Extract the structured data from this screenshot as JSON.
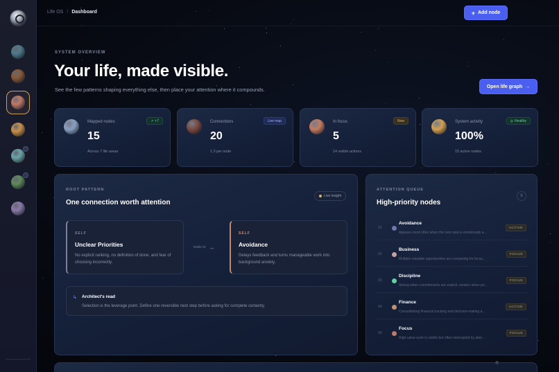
{
  "colors": {
    "accent": "#4a5ef0",
    "active_border": "#c9a25e",
    "green": "#5fd3a1",
    "amber": "#d9b36a"
  },
  "sidebar": {
    "logo_icon": "atom-logo-icon",
    "items": [
      {
        "icon": "earth-planet-icon",
        "color": "#4f7a8a"
      },
      {
        "icon": "ringed-planet-icon",
        "color": "#8a5a3a"
      },
      {
        "icon": "mars-planet-icon",
        "color": "#c07a66",
        "active": true
      },
      {
        "icon": "jupiter-planet-icon",
        "color": "#c8914a"
      },
      {
        "icon": "uranus-planet-icon",
        "color": "#6aa6a8",
        "badge": true
      },
      {
        "icon": "moss-planet-icon",
        "color": "#5f8a5a",
        "badge": true
      },
      {
        "icon": "violet-planet-icon",
        "color": "#8a7aa8"
      }
    ]
  },
  "topbar": {
    "breadcrumb_root": "Life OS",
    "breadcrumb_sep": "/",
    "breadcrumb_current": "Dashboard",
    "add_node_label": "Add node"
  },
  "hero": {
    "eyebrow": "SYSTEM OVERVIEW",
    "title": "Your life, made visible.",
    "subtitle": "See the few patterns shaping everything else, then place your attention where it compounds.",
    "open_graph_label": "Open life graph"
  },
  "stats": [
    {
      "label": "Mapped nodes",
      "value": "15",
      "foot": "Across 7 life areas",
      "chip": "+7",
      "chip_style": "green",
      "orb": "#8aa0c0"
    },
    {
      "label": "Connections",
      "value": "20",
      "foot": "1.3 per node",
      "chip": "Live map",
      "chip_style": "blue",
      "orb": "#7a4a40"
    },
    {
      "label": "In focus",
      "value": "5",
      "foot": "14 visible actions",
      "chip": "Now",
      "chip_style": "amber",
      "orb": "#c47a60"
    },
    {
      "label": "System activity",
      "value": "100%",
      "foot": "15 active nodes",
      "chip": "Healthy",
      "chip_style": "green",
      "orb": "#d3a050"
    }
  ],
  "root_pattern": {
    "eyebrow": "ROOT PATTERN",
    "title": "One connection worth attention",
    "live_label": "Live insight",
    "left": {
      "tag": "SELF",
      "title": "Unclear Priorities",
      "body": "No explicit ranking, no definition of done, and fear of choosing incorrectly."
    },
    "leads_to": "leads to",
    "right": {
      "tag": "SELF",
      "title": "Avoidance",
      "body": "Delays feedback and turns manageable work into background anxiety."
    },
    "architect_title": "Architect's read",
    "architect_body": "Selection is the leverage point. Define one reversible next step before asking for complete certainty."
  },
  "queue": {
    "eyebrow": "ATTENTION QUEUE",
    "title": "High-priority nodes",
    "count": "5",
    "items": [
      {
        "idx": "01",
        "name": "Avoidance",
        "desc": "Appears most often when the next step is emotionally a...",
        "status": "ACTIVE",
        "orb": "#6a7ab0"
      },
      {
        "idx": "02",
        "name": "Business",
        "desc": "Multiple valuable opportunities are competing for focus...",
        "status": "FOCUS",
        "orb": "#c7a0a0"
      },
      {
        "idx": "03",
        "name": "Discipline",
        "desc": "Strong when commitments are explicit; weaker when pri...",
        "status": "FOCUS",
        "orb": "#5fd3a1"
      },
      {
        "idx": "04",
        "name": "Finance",
        "desc": "Consolidating financial tracking and decision-making a...",
        "status": "ACTIVE",
        "orb": "#c49070"
      },
      {
        "idx": "05",
        "name": "Focus",
        "desc": "High-value work is visible but often interrupted by alter...",
        "status": "FOCUS",
        "orb": "#c07a66"
      }
    ]
  }
}
